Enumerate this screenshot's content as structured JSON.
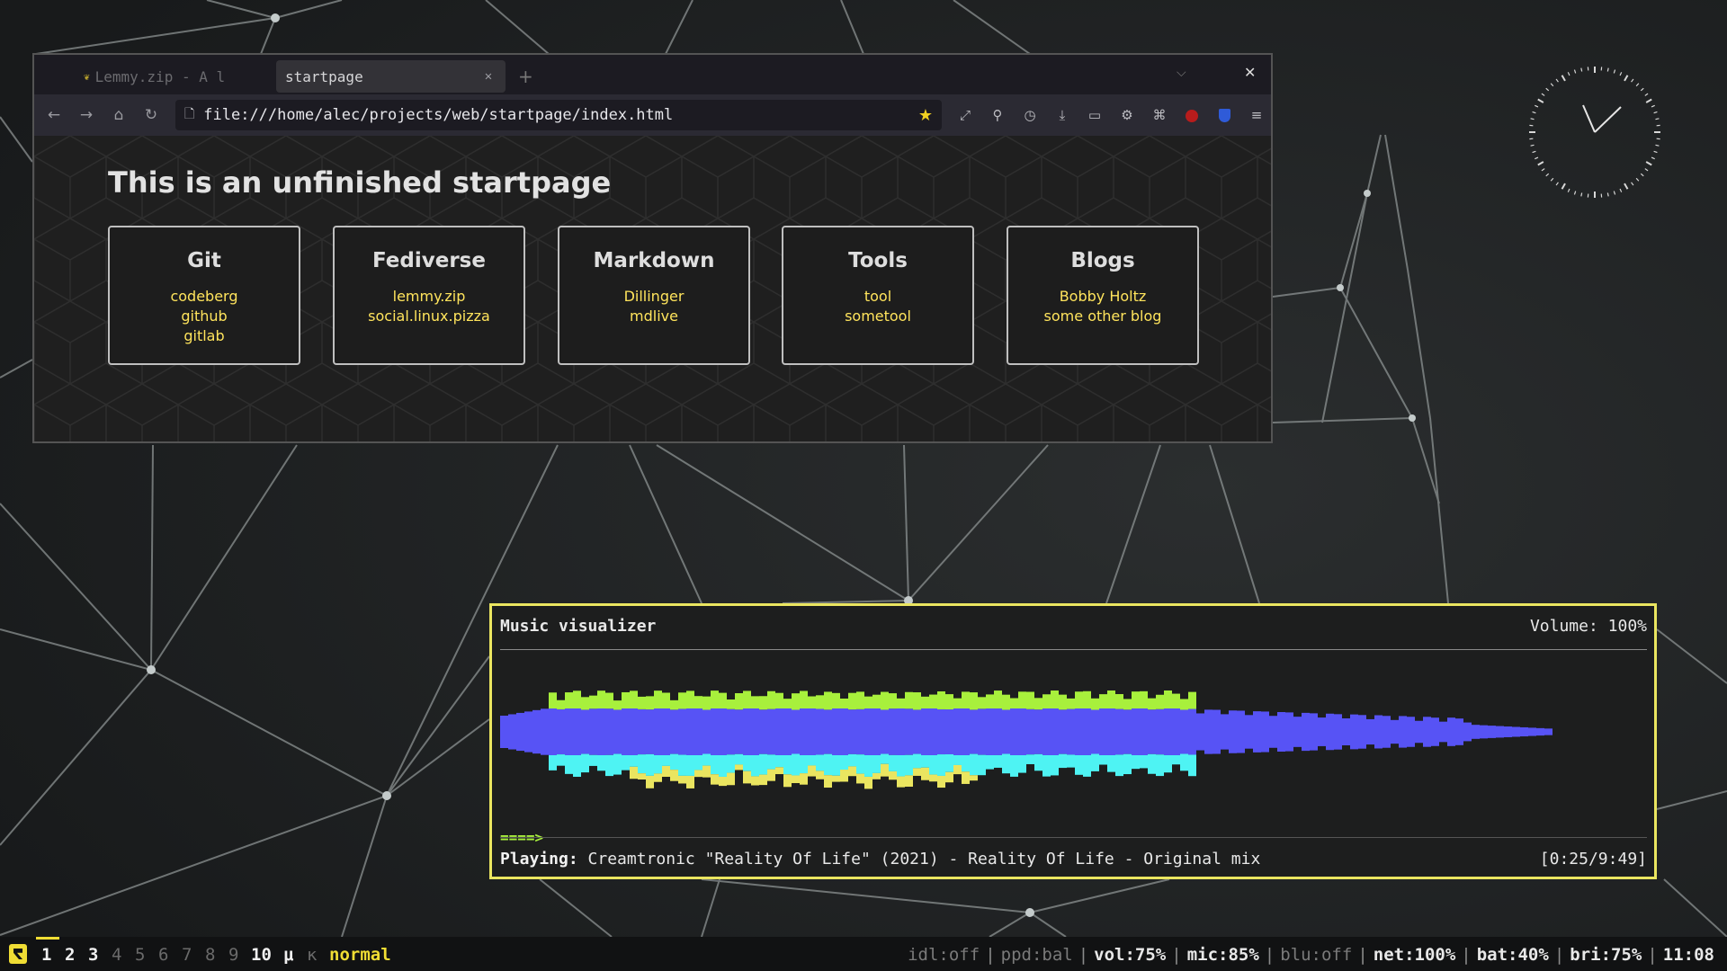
{
  "browser": {
    "tabs": [
      {
        "title": "Lemmy.zip - A l",
        "active": false,
        "icon": "squirrel-favicon"
      },
      {
        "title": "startpage",
        "active": true
      }
    ],
    "url": "file:///home/alec/projects/web/startpage/index.html",
    "toolbar_icons": [
      "fullscreen-icon",
      "search-icon",
      "history-icon",
      "download-icon",
      "container-icon",
      "settings-icon",
      "extensions-icon",
      "ublock-icon",
      "bitwarden-icon",
      "menu-icon"
    ]
  },
  "startpage": {
    "title": "This is an unfinished startpage",
    "cards": [
      {
        "title": "Git",
        "links": [
          "codeberg",
          "github",
          "gitlab"
        ]
      },
      {
        "title": "Fediverse",
        "links": [
          "lemmy.zip",
          "social.linux.pizza"
        ]
      },
      {
        "title": "Markdown",
        "links": [
          "Dillinger",
          "mdlive"
        ]
      },
      {
        "title": "Tools",
        "links": [
          "tool",
          "sometool"
        ]
      },
      {
        "title": "Blogs",
        "links": [
          "Bobby Holtz",
          "some other blog"
        ]
      }
    ]
  },
  "visualizer": {
    "title": "Music visualizer",
    "volume": "Volume: 100%",
    "progress": "====>",
    "playing_label": "Playing:",
    "track": "Creamtronic \"Reality Of Life\" (2021) - Reality Of Life - Original mix",
    "time": "[0:25/9:49]",
    "colors": {
      "blue": "#5753f5",
      "cyan": "#4ef3f3",
      "green": "#a8f03c",
      "yellow": "#eae560"
    }
  },
  "bar": {
    "workspaces": [
      {
        "label": "1",
        "occupied": true
      },
      {
        "label": "2",
        "occupied": true
      },
      {
        "label": "3",
        "occupied": true
      },
      {
        "label": "4",
        "occupied": false
      },
      {
        "label": "5",
        "occupied": false
      },
      {
        "label": "6",
        "occupied": false
      },
      {
        "label": "7",
        "occupied": false
      },
      {
        "label": "8",
        "occupied": false
      },
      {
        "label": "9",
        "occupied": false
      },
      {
        "label": "10",
        "occupied": true
      },
      {
        "label": "μ",
        "occupied": true
      },
      {
        "label": "κ",
        "occupied": false
      }
    ],
    "active_workspace": "1",
    "mode": "normal",
    "status": {
      "idle": "idl:off",
      "ppd": "ppd:bal",
      "vol": "vol:75%",
      "mic": "mic:85%",
      "blu": "blu:off",
      "net": "net:100%",
      "bat": "bat:40%",
      "bri": "bri:75%",
      "time": "11:08"
    },
    "accent": "#f0dd34"
  }
}
